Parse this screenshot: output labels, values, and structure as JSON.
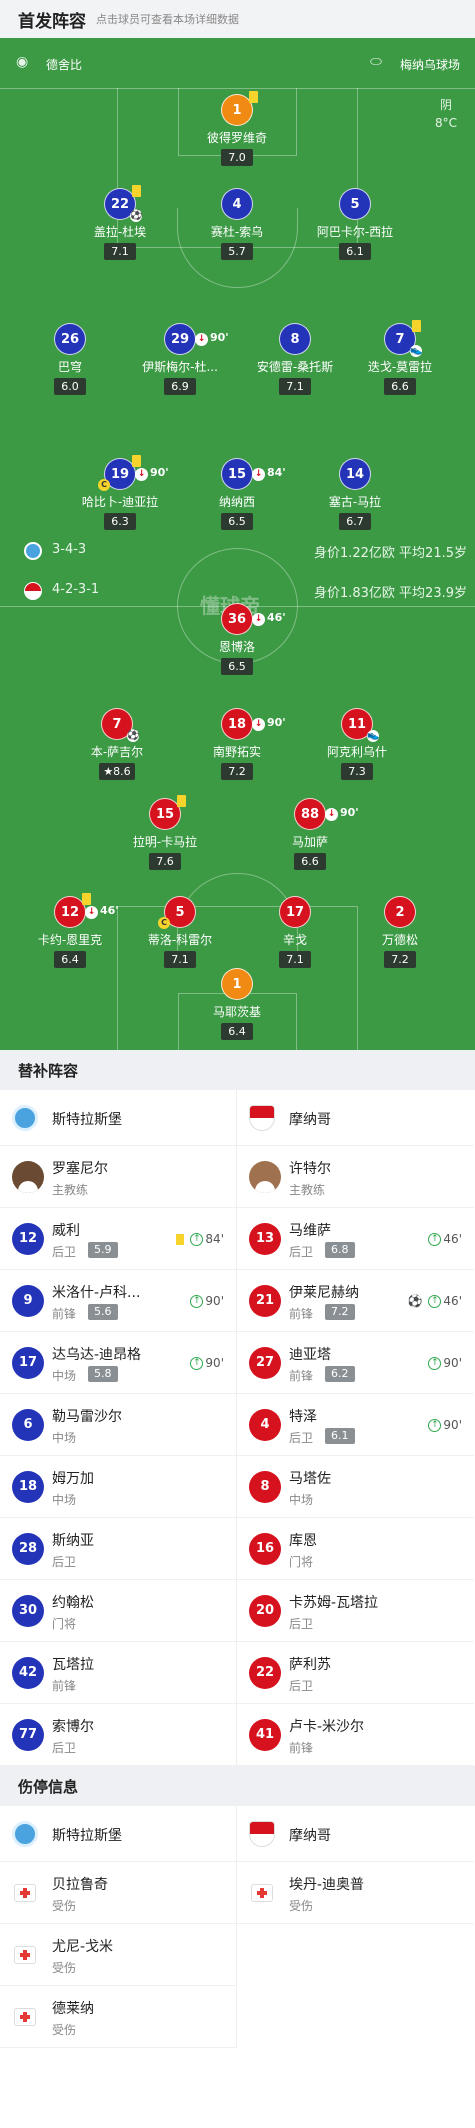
{
  "header": {
    "title": "首发阵容",
    "subtitle": "点击球员可查看本场详细数据"
  },
  "match": {
    "referee": "德舍比",
    "stadium": "梅纳乌球场",
    "weather": "阴",
    "temperature": "8°C"
  },
  "home_team": {
    "name": "斯特拉斯堡",
    "formation": "3-4-3",
    "value": "身价1.22亿欧",
    "avg_age": "平均21.5岁",
    "color": "#2334b8"
  },
  "away_team": {
    "name": "摩纳哥",
    "formation": "4-2-3-1",
    "value": "身价1.83亿欧",
    "avg_age": "平均23.9岁",
    "color": "#d6121e"
  },
  "watermark": "懂球帝",
  "home_lineup": [
    {
      "num": "1",
      "name": "彼得罗维奇",
      "rating": "7.0",
      "yellow": true
    },
    {
      "num": "22",
      "name": "盖拉-杜埃",
      "rating": "7.1",
      "yellow": true,
      "goal": true
    },
    {
      "num": "4",
      "name": "赛杜-索乌",
      "rating": "5.7"
    },
    {
      "num": "5",
      "name": "阿巴卡尔-西拉",
      "rating": "6.1"
    },
    {
      "num": "26",
      "name": "巴穹",
      "rating": "6.0"
    },
    {
      "num": "29",
      "name": "伊斯梅尔-杜...",
      "rating": "6.9",
      "sub": "90'"
    },
    {
      "num": "8",
      "name": "安德雷-桑托斯",
      "rating": "7.1"
    },
    {
      "num": "7",
      "name": "迭戈-莫雷拉",
      "rating": "6.6",
      "yellow": true,
      "assist": true
    },
    {
      "num": "19",
      "name": "哈比卜-迪亚拉",
      "rating": "6.3",
      "yellow": true,
      "sub": "90'",
      "captain": true
    },
    {
      "num": "15",
      "name": "纳纳西",
      "rating": "6.5",
      "sub": "84'"
    },
    {
      "num": "14",
      "name": "塞古-马拉",
      "rating": "6.7"
    }
  ],
  "away_lineup": [
    {
      "num": "36",
      "name": "恩博洛",
      "rating": "6.5",
      "sub": "46'"
    },
    {
      "num": "7",
      "name": "本-萨吉尔",
      "rating": "8.6",
      "goal": true,
      "star": true
    },
    {
      "num": "18",
      "name": "南野拓实",
      "rating": "7.2",
      "sub": "90'"
    },
    {
      "num": "11",
      "name": "阿克利乌什",
      "rating": "7.3",
      "assist": true
    },
    {
      "num": "15",
      "name": "拉明-卡马拉",
      "rating": "7.6",
      "yellow": true
    },
    {
      "num": "88",
      "name": "马加萨",
      "rating": "6.6",
      "sub": "90'"
    },
    {
      "num": "12",
      "name": "卡约-恩里克",
      "rating": "6.4",
      "yellow": true,
      "sub": "46'"
    },
    {
      "num": "5",
      "name": "蒂洛-科雷尔",
      "rating": "7.1",
      "captain": true
    },
    {
      "num": "17",
      "name": "辛戈",
      "rating": "7.1"
    },
    {
      "num": "2",
      "name": "万德松",
      "rating": "7.2"
    },
    {
      "num": "1",
      "name": "马耶茨基",
      "rating": "6.4"
    }
  ],
  "bench": {
    "title": "替补阵容",
    "home_team": "斯特拉斯堡",
    "away_team": "摩纳哥",
    "home_coach": {
      "name": "罗塞尼尔",
      "role": "主教练"
    },
    "away_coach": {
      "name": "许特尔",
      "role": "主教练"
    },
    "home": [
      {
        "num": "12",
        "name": "威利",
        "pos": "后卫",
        "rating": "5.9",
        "yellow": true,
        "in": "84'"
      },
      {
        "num": "9",
        "name": "米洛什-卢科...",
        "pos": "前锋",
        "rating": "5.6",
        "in": "90'"
      },
      {
        "num": "17",
        "name": "达乌达-迪昂格",
        "pos": "中场",
        "rating": "5.8",
        "in": "90'"
      },
      {
        "num": "6",
        "name": "勒马雷沙尔",
        "pos": "中场"
      },
      {
        "num": "18",
        "name": "姆万加",
        "pos": "中场"
      },
      {
        "num": "28",
        "name": "斯纳亚",
        "pos": "后卫"
      },
      {
        "num": "30",
        "name": "约翰松",
        "pos": "门将"
      },
      {
        "num": "42",
        "name": "瓦塔拉",
        "pos": "前锋"
      },
      {
        "num": "77",
        "name": "索博尔",
        "pos": "后卫"
      }
    ],
    "away": [
      {
        "num": "13",
        "name": "马维萨",
        "pos": "后卫",
        "rating": "6.8",
        "in": "46'"
      },
      {
        "num": "21",
        "name": "伊莱尼赫纳",
        "pos": "前锋",
        "rating": "7.2",
        "goal": true,
        "in": "46'"
      },
      {
        "num": "27",
        "name": "迪亚塔",
        "pos": "前锋",
        "rating": "6.2",
        "in": "90'"
      },
      {
        "num": "4",
        "name": "特泽",
        "pos": "后卫",
        "rating": "6.1",
        "in": "90'"
      },
      {
        "num": "8",
        "name": "马塔佐",
        "pos": "中场"
      },
      {
        "num": "16",
        "name": "库恩",
        "pos": "门将"
      },
      {
        "num": "20",
        "name": "卡苏姆-瓦塔拉",
        "pos": "后卫"
      },
      {
        "num": "22",
        "name": "萨利苏",
        "pos": "后卫"
      },
      {
        "num": "41",
        "name": "卢卡-米沙尔",
        "pos": "前锋"
      }
    ]
  },
  "injuries": {
    "title": "伤停信息",
    "home_team": "斯特拉斯堡",
    "away_team": "摩纳哥",
    "home": [
      {
        "name": "贝拉鲁奇",
        "status": "受伤"
      },
      {
        "name": "尤尼-戈米",
        "status": "受伤"
      },
      {
        "name": "德莱纳",
        "status": "受伤"
      }
    ],
    "away": [
      {
        "name": "埃丹-迪奥普",
        "status": "受伤"
      }
    ]
  }
}
